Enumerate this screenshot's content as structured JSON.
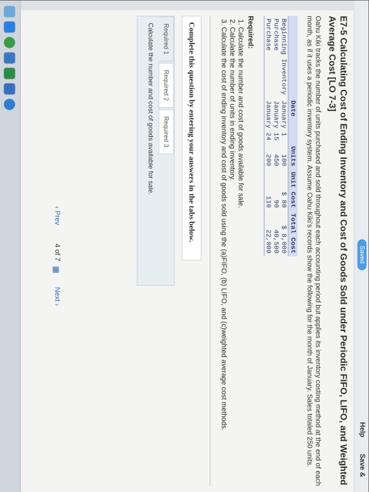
{
  "topbar": {
    "saved_label": "Saved",
    "help_label": "Help",
    "save_exit_label": "Save &"
  },
  "question": {
    "title": "E7-5 Calculating Cost of Ending Inventory and Cost of Goods Sold under Periodic FIFO, LIFO, and Weighted Average Cost [LO 7-3]",
    "intro": "Oahu Kiki tracks the number of units purchased and sold throughout each accounting period but applies its inventory costing method at the end of each month, as if it uses a periodic inventory system. Assume Oahu Kiki's records show the following for the month of January. Sales totaled 250 units.",
    "table": {
      "headers": [
        "",
        "Date",
        "Units",
        "Unit Cost",
        "Total Cost"
      ],
      "rows": [
        [
          "Beginning Inventory",
          "January 1",
          "100",
          "$ 80",
          "$ 8,000"
        ],
        [
          "Purchase",
          "January 15",
          "450",
          "90",
          "40,500"
        ],
        [
          "Purchase",
          "January 24",
          "200",
          "110",
          "22,000"
        ]
      ]
    },
    "required_title": "Required:",
    "required_items": [
      "Calculate the number and cost of goods available for sale.",
      "Calculate the number of units in ending inventory.",
      "Calculate the cost of ending inventory and cost of goods sold using the (a)FIFO, (b) LIFO, and (c)weighted average cost methods."
    ],
    "complete_prompt": "Complete this question by entering your answers in the tabs below.",
    "tabs": [
      "Required 1",
      "Required 2",
      "Required 3"
    ],
    "tab_body": "Calculate the number and cost of goods available for sale."
  },
  "navigation": {
    "prev_label": "Prev",
    "page_label": "4 of 7",
    "next_label": "Next"
  }
}
